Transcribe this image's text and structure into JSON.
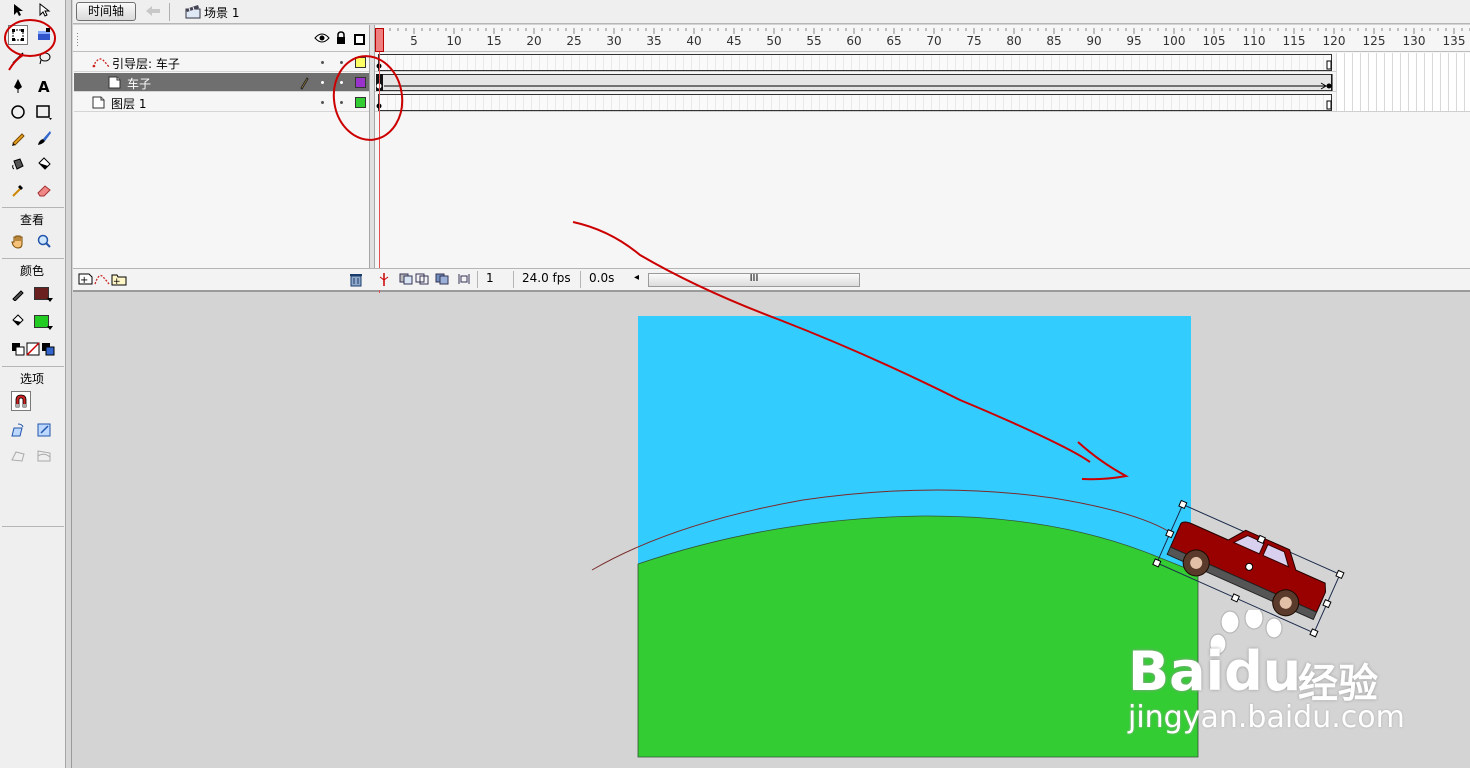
{
  "app": {
    "accent_color": "#cc0000",
    "stage_sky_color": "#33ccff",
    "stage_ground_color": "#33cc33"
  },
  "topbar": {
    "timeline_button": "时间轴",
    "scene_label": "场景 1",
    "back_icon": "back-arrow-icon",
    "scene_icon": "scene-clapper-icon"
  },
  "toolbox": {
    "view_title": "查看",
    "color_title": "颜色",
    "options_title": "选项",
    "stroke_color": "#6b2020",
    "fill_color": "#22cc22",
    "tools": [
      "arrow",
      "subselect",
      "free-transform",
      "fill-transform",
      "line",
      "lasso",
      "pen",
      "text",
      "oval",
      "rectangle",
      "pencil",
      "brush",
      "ink-bottle",
      "paint-bucket",
      "eyedropper",
      "eraser",
      "hand",
      "zoom"
    ]
  },
  "timeline": {
    "ruler_ticks": [
      "5",
      "10",
      "15",
      "20",
      "25",
      "30",
      "35",
      "40",
      "45",
      "50",
      "55",
      "60",
      "65",
      "70",
      "75",
      "80",
      "85",
      "90",
      "95",
      "100",
      "105",
      "110",
      "115",
      "120",
      "125",
      "130",
      "135"
    ],
    "layers": [
      {
        "name": "引导层: 车子",
        "color": "#ffff66",
        "selected": false
      },
      {
        "name": "车子",
        "color": "#9933cc",
        "selected": true
      },
      {
        "name": "图层 1",
        "color": "#33cc33",
        "selected": false
      }
    ],
    "footer": {
      "current_frame": "1",
      "fps": "24.0 fps",
      "elapsed": "0.0s",
      "scroll_label": "III"
    }
  },
  "watermark": {
    "brand": "Bai",
    "brand_tail": "du",
    "chinese": "经验",
    "url": "jingyan.baidu.com"
  }
}
